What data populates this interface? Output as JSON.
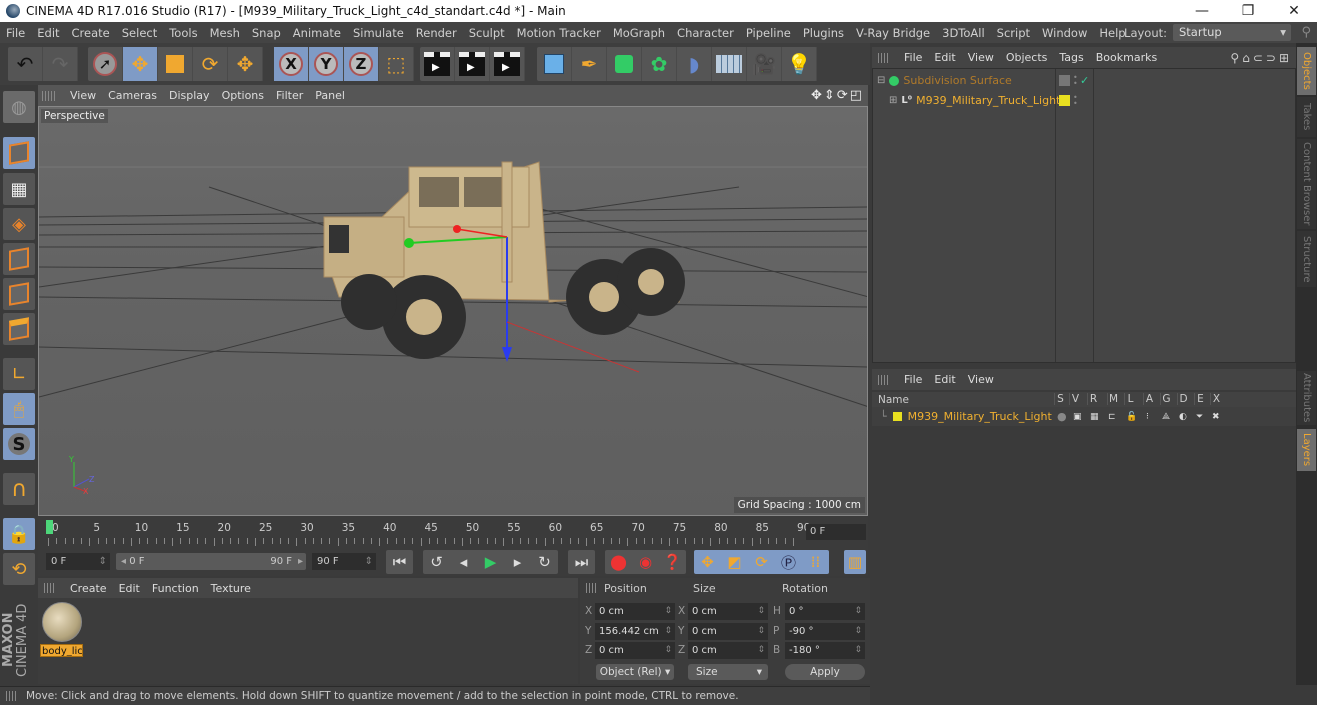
{
  "window": {
    "title": "CINEMA 4D R17.016 Studio (R17) - [M939_Military_Truck_Light_c4d_standart.c4d *] - Main",
    "controls": [
      "minimize",
      "restore",
      "close"
    ]
  },
  "menubar": {
    "items": [
      "File",
      "Edit",
      "Create",
      "Select",
      "Tools",
      "Mesh",
      "Snap",
      "Animate",
      "Simulate",
      "Render",
      "Sculpt",
      "Motion Tracker",
      "MoGraph",
      "Character",
      "Pipeline",
      "Plugins",
      "V-Ray Bridge",
      "3DToAll",
      "Script",
      "Window",
      "Help"
    ],
    "layout_label": "Layout:",
    "layout_value": "Startup"
  },
  "toolbar": {
    "groups": [
      {
        "name": "history",
        "buttons": [
          {
            "icon": "undo-icon",
            "active": false
          },
          {
            "icon": "redo-icon",
            "active": false
          }
        ]
      },
      {
        "name": "tools",
        "buttons": [
          {
            "icon": "live-selection-icon",
            "active": false
          },
          {
            "icon": "move-icon",
            "active": true
          },
          {
            "icon": "scale-icon",
            "active": false
          },
          {
            "icon": "rotate-icon",
            "active": false
          },
          {
            "icon": "recent-tool-icon",
            "active": false
          }
        ]
      },
      {
        "name": "axis",
        "buttons": [
          {
            "icon": "x-axis-icon",
            "label": "X",
            "active": true
          },
          {
            "icon": "y-axis-icon",
            "label": "Y",
            "active": true
          },
          {
            "icon": "z-axis-icon",
            "label": "Z",
            "active": true
          },
          {
            "icon": "coordinate-system-icon",
            "active": false
          }
        ]
      },
      {
        "name": "render",
        "buttons": [
          {
            "icon": "render-view-icon"
          },
          {
            "icon": "render-picture-viewer-icon"
          },
          {
            "icon": "render-settings-icon"
          }
        ]
      },
      {
        "name": "create",
        "buttons": [
          {
            "icon": "cube-icon"
          },
          {
            "icon": "pen-spline-icon"
          },
          {
            "icon": "subdivision-icon"
          },
          {
            "icon": "cloner-icon"
          },
          {
            "icon": "deformer-icon"
          },
          {
            "icon": "floor-icon"
          },
          {
            "icon": "camera-icon"
          },
          {
            "icon": "light-icon"
          }
        ]
      }
    ]
  },
  "left_toolbar": {
    "buttons": [
      "make-editable-icon",
      "model-mode-icon",
      "texture-mode-icon",
      "workplane-icon",
      "points-mode-icon",
      "edges-mode-icon",
      "polygons-mode-icon",
      "axis-mode-icon",
      "tweak-mode-icon",
      "solo-icon",
      "snap-magnet-icon",
      "workplane-lock-icon",
      "workplane-rotate-icon"
    ],
    "active": [
      "model-mode-icon",
      "tweak-mode-icon",
      "solo-icon",
      "workplane-lock-icon"
    ],
    "brand_line1": "MAXON",
    "brand_line2": "CINEMA 4D"
  },
  "viewport": {
    "menu": [
      "View",
      "Cameras",
      "Display",
      "Options",
      "Filter",
      "Panel"
    ],
    "camera_label": "Perspective",
    "grid_spacing": "Grid Spacing : 1000 cm",
    "axis_labels": {
      "y": "Y",
      "z": "Z",
      "x": "X"
    }
  },
  "timeline": {
    "ticks": [
      "0",
      "5",
      "10",
      "15",
      "20",
      "25",
      "30",
      "35",
      "40",
      "45",
      "50",
      "55",
      "60",
      "65",
      "70",
      "75",
      "80",
      "85",
      "90"
    ],
    "current_frame": "0 F",
    "start_field": "0 F",
    "range_start": "0 F",
    "range_end": "90 F",
    "end_field": "90 F",
    "playhead_frame": 0,
    "max_frame": 90
  },
  "transport": {
    "buttons": [
      "goto-start-icon",
      "previous-key-icon",
      "previous-frame-icon",
      "play-icon",
      "next-frame-icon",
      "next-key-icon",
      "goto-end-icon"
    ],
    "record": [
      "record-keys-icon",
      "autokey-icon",
      "keyframe-selection-icon"
    ],
    "key_tracks": [
      "key-position-icon",
      "key-scale-icon",
      "key-rotation-icon",
      "key-parameter-icon",
      "key-pla-icon"
    ],
    "timeline_button": "timeline-icon"
  },
  "material_manager": {
    "menu": [
      "Create",
      "Edit",
      "Function",
      "Texture"
    ],
    "materials": [
      {
        "name": "body_lic"
      }
    ]
  },
  "coordinates": {
    "headers": [
      "Position",
      "Size",
      "Rotation"
    ],
    "rows": [
      {
        "pos_axis": "X",
        "pos": "0 cm",
        "size_axis": "X",
        "size": "0 cm",
        "rot_axis": "H",
        "rot": "0 °"
      },
      {
        "pos_axis": "Y",
        "pos": "156.442 cm",
        "size_axis": "Y",
        "size": "0 cm",
        "rot_axis": "P",
        "rot": "-90 °"
      },
      {
        "pos_axis": "Z",
        "pos": "0 cm",
        "size_axis": "Z",
        "size": "0 cm",
        "rot_axis": "B",
        "rot": "-180 °"
      }
    ],
    "mode_dropdown": "Object (Rel)",
    "size_dropdown": "Size",
    "apply_label": "Apply"
  },
  "status_bar": {
    "text": "Move: Click and drag to move elements. Hold down SHIFT to quantize movement / add to the selection in point mode, CTRL to remove."
  },
  "object_manager": {
    "menu": [
      "File",
      "Edit",
      "View",
      "Objects",
      "Tags",
      "Bookmarks"
    ],
    "objects": [
      {
        "name": "Subdivision Surface",
        "level": 0,
        "color": "#b07a2a",
        "icon": "subdivision-surface-icon",
        "tags": [
          "check-icon"
        ]
      },
      {
        "name": "M939_Military_Truck_Light",
        "level": 1,
        "color": "#f0b030",
        "icon": "null-object-icon",
        "layer_color": "#e8e020"
      }
    ]
  },
  "layer_manager": {
    "menu": [
      "File",
      "Edit",
      "View"
    ],
    "columns": [
      "Name",
      "S",
      "V",
      "R",
      "M",
      "L",
      "A",
      "G",
      "D",
      "E",
      "X"
    ],
    "layers": [
      {
        "name": "M939_Military_Truck_Light",
        "color": "#e8e020"
      }
    ]
  },
  "side_tabs": {
    "top": [
      {
        "label": "Objects",
        "active": true
      },
      {
        "label": "Takes",
        "active": false
      },
      {
        "label": "Content Browser",
        "active": false
      },
      {
        "label": "Structure",
        "active": false
      }
    ],
    "bottom": [
      {
        "label": "Attributes",
        "active": false
      },
      {
        "label": "Layers",
        "active": true
      }
    ]
  },
  "colors": {
    "accent_orange": "#f0a830",
    "active_button": "#7f9bc6",
    "panel_bg": "#3c3c3c"
  }
}
